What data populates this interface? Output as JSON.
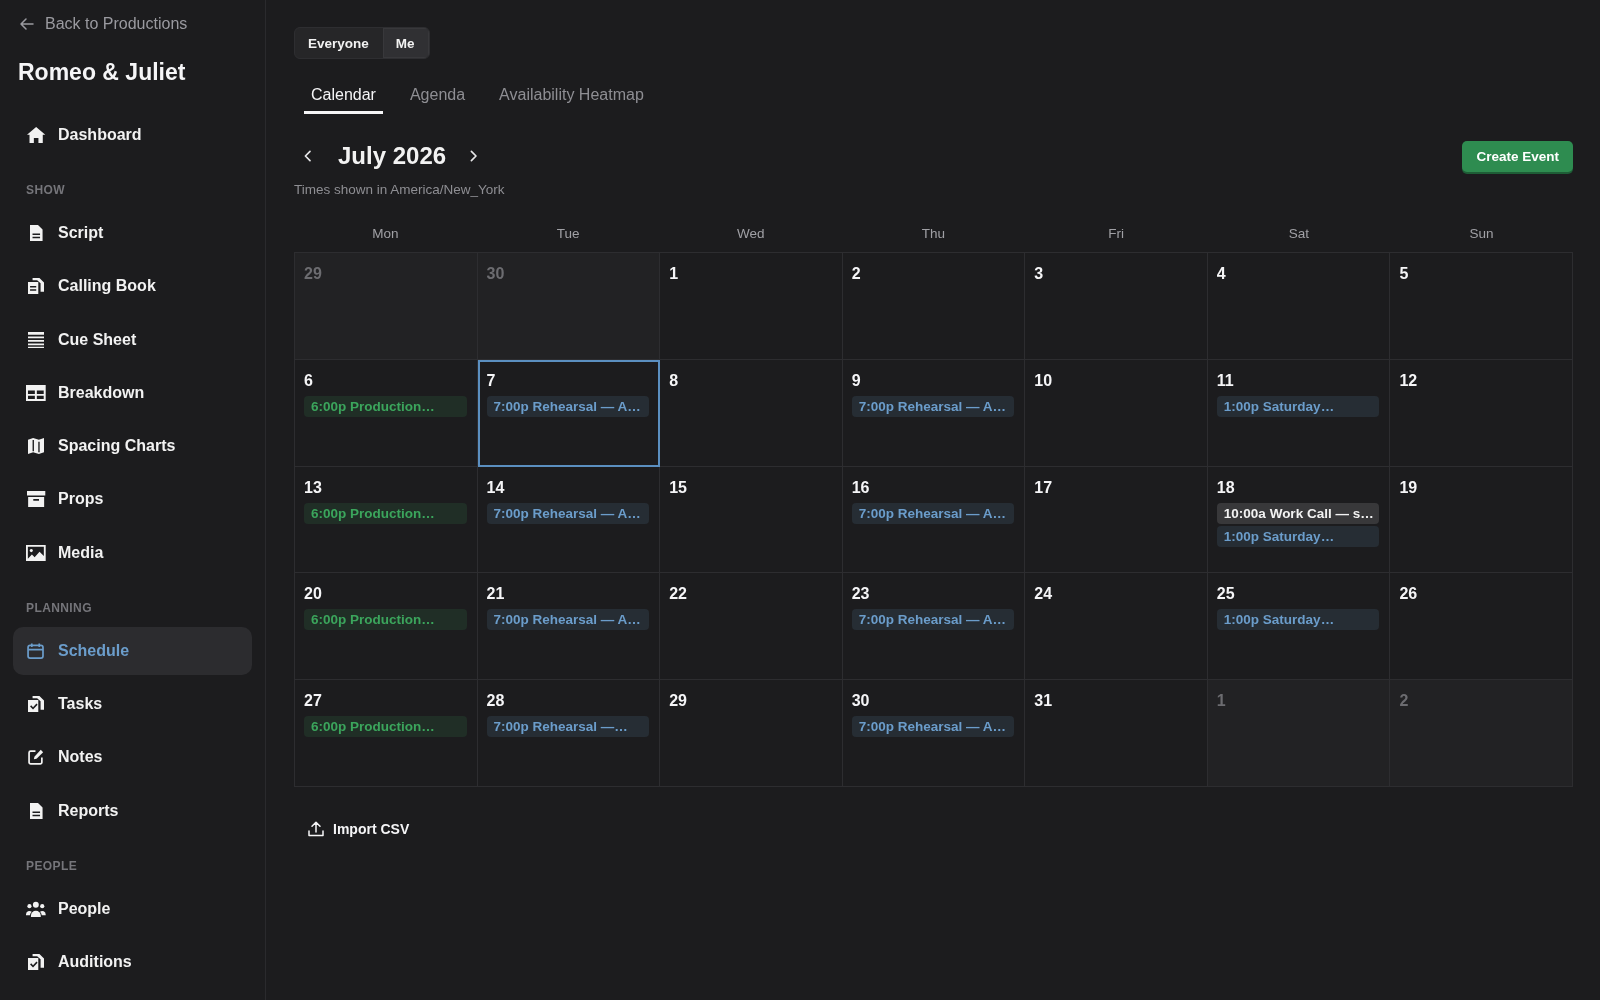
{
  "sidebar": {
    "back_link": "Back to Productions",
    "title": "Romeo & Juliet",
    "items": [
      {
        "label": "Dashboard",
        "selected": false
      }
    ],
    "sections": [
      {
        "heading": "SHOW",
        "items": [
          {
            "label": "Script",
            "selected": false
          },
          {
            "label": "Calling Book",
            "selected": false
          },
          {
            "label": "Cue Sheet",
            "selected": false
          },
          {
            "label": "Breakdown",
            "selected": false
          },
          {
            "label": "Spacing Charts",
            "selected": false
          },
          {
            "label": "Props",
            "selected": false
          },
          {
            "label": "Media",
            "selected": false
          }
        ]
      },
      {
        "heading": "PLANNING",
        "items": [
          {
            "label": "Schedule",
            "selected": true
          },
          {
            "label": "Tasks",
            "selected": false
          },
          {
            "label": "Notes",
            "selected": false
          },
          {
            "label": "Reports",
            "selected": false
          }
        ]
      },
      {
        "heading": "PEOPLE",
        "items": [
          {
            "label": "People",
            "selected": false
          },
          {
            "label": "Auditions",
            "selected": false
          }
        ]
      }
    ]
  },
  "scope_toggle": [
    {
      "label": "Everyone",
      "selected": false
    },
    {
      "label": "Me",
      "selected": true
    }
  ],
  "tabs": [
    {
      "label": "Calendar",
      "selected": true
    },
    {
      "label": "Agenda",
      "selected": false
    },
    {
      "label": "Availability Heatmap",
      "selected": false
    }
  ],
  "calendar": {
    "month": "July 2026",
    "timezone_note": "Times shown in America/New_York",
    "create_button": "Create Event",
    "weekdays": [
      "Mon",
      "Tue",
      "Wed",
      "Thu",
      "Fri",
      "Sat",
      "Sun"
    ],
    "weeks": [
      {
        "days": [
          {
            "day": "29",
            "in_month": false,
            "selected": false
          },
          {
            "day": "30",
            "in_month": false,
            "selected": false
          },
          {
            "day": "1",
            "in_month": true,
            "selected": false
          },
          {
            "day": "2",
            "in_month": true,
            "selected": false
          },
          {
            "day": "3",
            "in_month": true,
            "selected": false
          },
          {
            "day": "4",
            "in_month": true,
            "selected": false
          },
          {
            "day": "5",
            "in_month": true,
            "selected": false
          }
        ]
      },
      {
        "days": [
          {
            "day": "6",
            "in_month": true,
            "selected": false,
            "events": [
              {
                "label": "6:00p Production…",
                "color": "#3ba55c"
              }
            ]
          },
          {
            "day": "7",
            "in_month": true,
            "selected": true,
            "events": [
              {
                "label": "7:00p Rehearsal — A…",
                "color": "#6b9dcb"
              }
            ]
          },
          {
            "day": "8",
            "in_month": true,
            "selected": false
          },
          {
            "day": "9",
            "in_month": true,
            "selected": false,
            "events": [
              {
                "label": "7:00p Rehearsal — A…",
                "color": "#6b9dcb"
              }
            ]
          },
          {
            "day": "10",
            "in_month": true,
            "selected": false
          },
          {
            "day": "11",
            "in_month": true,
            "selected": false,
            "events": [
              {
                "label": "1:00p Saturday…",
                "color": "#6b9dcb"
              }
            ]
          },
          {
            "day": "12",
            "in_month": true,
            "selected": false
          }
        ]
      },
      {
        "days": [
          {
            "day": "13",
            "in_month": true,
            "selected": false,
            "events": [
              {
                "label": "6:00p Production…",
                "color": "#3ba55c"
              }
            ]
          },
          {
            "day": "14",
            "in_month": true,
            "selected": false,
            "events": [
              {
                "label": "7:00p Rehearsal — A…",
                "color": "#6b9dcb"
              }
            ]
          },
          {
            "day": "15",
            "in_month": true,
            "selected": false
          },
          {
            "day": "16",
            "in_month": true,
            "selected": false,
            "events": [
              {
                "label": "7:00p Rehearsal — A…",
                "color": "#6b9dcb"
              }
            ]
          },
          {
            "day": "17",
            "in_month": true,
            "selected": false
          },
          {
            "day": "18",
            "in_month": true,
            "selected": false,
            "events": [
              {
                "label": "10:00a Work Call — s…",
                "color": "#f2f2f2"
              },
              {
                "label": "1:00p Saturday…",
                "color": "#6b9dcb"
              }
            ]
          },
          {
            "day": "19",
            "in_month": true,
            "selected": false
          }
        ]
      },
      {
        "days": [
          {
            "day": "20",
            "in_month": true,
            "selected": false,
            "events": [
              {
                "label": "6:00p Production…",
                "color": "#3ba55c"
              }
            ]
          },
          {
            "day": "21",
            "in_month": true,
            "selected": false,
            "events": [
              {
                "label": "7:00p Rehearsal — A…",
                "color": "#6b9dcb"
              }
            ]
          },
          {
            "day": "22",
            "in_month": true,
            "selected": false
          },
          {
            "day": "23",
            "in_month": true,
            "selected": false,
            "events": [
              {
                "label": "7:00p Rehearsal — A…",
                "color": "#6b9dcb"
              }
            ]
          },
          {
            "day": "24",
            "in_month": true,
            "selected": false
          },
          {
            "day": "25",
            "in_month": true,
            "selected": false,
            "events": [
              {
                "label": "1:00p Saturday…",
                "color": "#6b9dcb"
              }
            ]
          },
          {
            "day": "26",
            "in_month": true,
            "selected": false
          }
        ]
      },
      {
        "days": [
          {
            "day": "27",
            "in_month": true,
            "selected": false,
            "events": [
              {
                "label": "6:00p Production…",
                "color": "#3ba55c"
              }
            ]
          },
          {
            "day": "28",
            "in_month": true,
            "selected": false,
            "events": [
              {
                "label": "7:00p Rehearsal —…",
                "color": "#6b9dcb"
              }
            ]
          },
          {
            "day": "29",
            "in_month": true,
            "selected": false
          },
          {
            "day": "30",
            "in_month": true,
            "selected": false,
            "events": [
              {
                "label": "7:00p Rehearsal — A…",
                "color": "#6b9dcb"
              }
            ]
          },
          {
            "day": "31",
            "in_month": true,
            "selected": false
          },
          {
            "day": "1",
            "in_month": false,
            "selected": false
          },
          {
            "day": "2",
            "in_month": false,
            "selected": false
          }
        ]
      }
    ]
  },
  "import_button": "Import CSV"
}
